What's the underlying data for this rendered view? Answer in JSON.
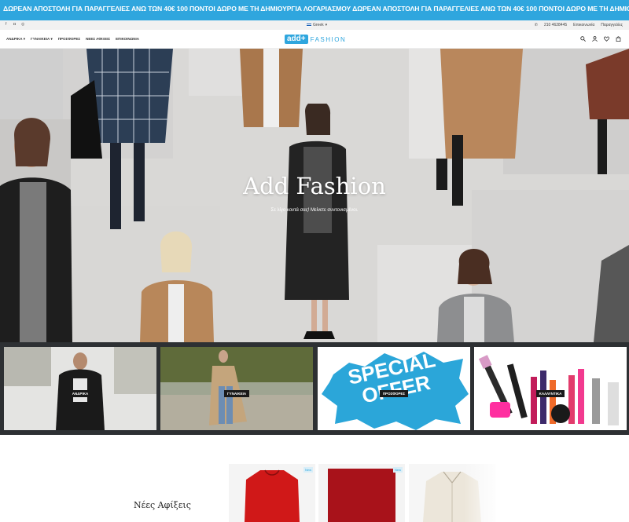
{
  "announcement": {
    "text": "ΔΩΡΕΑΝ ΑΠΟΣΤΟΛΗ ΓΙΑ ΠΑΡΑΓΓΕΛΙΕΣ ΑΝΩ ΤΩΝ 40€   100 ΠΟΝΤΟΙ ΔΩΡΟ ΜΕ ΤΗ ΔΗΜΙΟΥΡΓΙΑ ΛΟΓΑΡΙΑΣΜΟΥ   ΔΩΡΕΑΝ ΑΠΟΣΤΟΛΗ ΓΙΑ ΠΑΡΑΓΓΕΛΙΕΣ ΑΝΩ ΤΩΝ 40€   100 ΠΟΝΤΟΙ ΔΩΡΟ ΜΕ ΤΗ ΔΗΜΙΟΥΡΓΙΑ ΛΟΓΑΡΙΑΣΜΟΥ"
  },
  "utility": {
    "language": "Greek",
    "phone": "210 4628445",
    "contact": "Επικοινωνία",
    "orders": "Παραγγελίες"
  },
  "nav": {
    "items": [
      "ΑΝΔΡΙΚΑ",
      "ΓΥΝΑΙΚΕΙΑ",
      "ΠΡΟΣΦΟΡΕΣ",
      "ΝΕΕΣ ΑΦΙΞΕΙΣ",
      "ΕΠΙΚΟΙΝΩΝΙΑ"
    ],
    "logo_box": "add+",
    "logo_word": "FASHION"
  },
  "hero": {
    "title": "Add Fashion",
    "subtitle": "Σε λίγο κοντά σας! Μείνετε συντονισμένοι."
  },
  "categories": [
    {
      "label": "ΑΝΔΡΙΚΑ"
    },
    {
      "label": "ΓΥΝΑΙΚΕΙΑ"
    },
    {
      "label": "ΠΡΟΣΦΟΡΕΣ",
      "special_line1": "SPECIAL",
      "special_line2": "OFFER"
    },
    {
      "label": "ΚΑΛΛΥΝΤΙΚΑ"
    }
  ],
  "arrivals": {
    "title": "Νέες Αφίξεις",
    "badge": "New"
  },
  "colors": {
    "brand": "#2fa6de",
    "dark_strip": "#2d3033"
  }
}
